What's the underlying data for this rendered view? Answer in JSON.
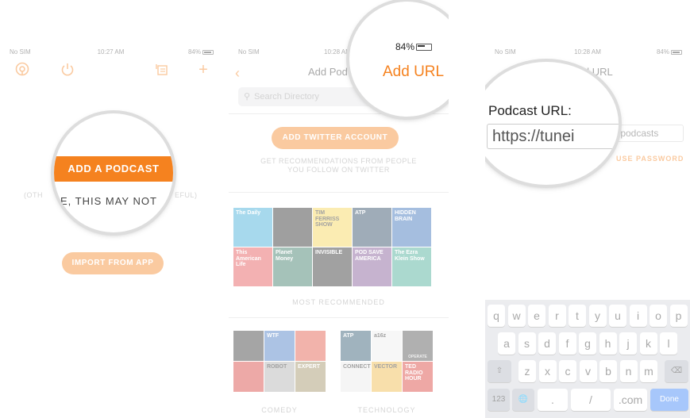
{
  "panel1": {
    "status": {
      "carrier": "No SIM",
      "time": "10:27 AM",
      "battery": "84%"
    },
    "toolbar": {
      "icons": [
        "podcast-icon",
        "power-icon",
        "episode-list-icon",
        "plus-icon"
      ],
      "plus": "+"
    },
    "add_podcast": "ADD A PODCAST",
    "note_left": "(OTH",
    "note_mid": "E, THIS MAY NOT",
    "note_right": "EFUL)",
    "import_button": "IMPORT FROM APP",
    "accent": "#f5821f"
  },
  "panel2": {
    "status": {
      "carrier": "No SIM",
      "time": "10:28 AM",
      "battery": "84%"
    },
    "nav_title": "Add Podc",
    "add_url": "Add URL",
    "search_placeholder": "Search Directory",
    "twitter_button": "ADD TWITTER ACCOUNT",
    "recommend_line1": "GET RECOMMENDATIONS FROM PEOPLE",
    "recommend_line2": "YOU FOLLOW ON TWITTER",
    "most_recommended": "MOST RECOMMENDED",
    "tiles": [
      {
        "text": "The Daily",
        "color": "#2fa7d6"
      },
      {
        "text": "",
        "color": "#1c1c1c"
      },
      {
        "text": "TIM FERRISS SHOW",
        "color": "#f6d24a"
      },
      {
        "text": "ATP",
        "color": "#1c3c58"
      },
      {
        "text": "HIDDEN BRAIN",
        "color": "#2a66b4"
      },
      {
        "text": "This American Life",
        "color": "#e3484a"
      },
      {
        "text": "Planet Money",
        "color": "#2c6f5b"
      },
      {
        "text": "INVISIBLE",
        "color": "#222222"
      },
      {
        "text": "POD SAVE AMERICA",
        "color": "#7a4d8f"
      },
      {
        "text": "The Ezra Klein Show",
        "color": "#3aa58f"
      }
    ],
    "comedy_tiles": [
      {
        "text": "",
        "color": "#2a2a2a"
      },
      {
        "text": "WTF",
        "color": "#3b73c0"
      },
      {
        "text": "",
        "color": "#e24d3a"
      },
      {
        "text": "",
        "color": "#d63530"
      },
      {
        "text": "ROBOT",
        "color": "#aaaaaa"
      },
      {
        "text": "EXPERT",
        "color": "#9b8a5a"
      }
    ],
    "tech_tiles": [
      {
        "text": "ATP",
        "color": "#1f4d66"
      },
      {
        "text": "a16z",
        "color": "#eeeeee"
      },
      {
        "text": "",
        "color": "#444444"
      },
      {
        "text": "CONNECTED",
        "color": "#e9e9e9"
      },
      {
        "text": "VECTOR",
        "color": "#f0b43a"
      },
      {
        "text": "TED RADIO HOUR",
        "color": "#d8322c"
      }
    ],
    "tech_sub": "OPERATE",
    "comedy": "COMEDY",
    "technology": "TECHNOLOGY"
  },
  "panel3": {
    "status": {
      "carrier": "No SIM",
      "time": "10:28 AM",
      "battery": "84%"
    },
    "nav_title": "Add URL",
    "url_label": "Podcast URL:",
    "url_value": "https://tunei",
    "url_value_tail": "m/podcasts",
    "use_password": "USE PASSWORD",
    "keyboard": {
      "row1": [
        "q",
        "w",
        "e",
        "r",
        "t",
        "y",
        "u",
        "i",
        "o",
        "p"
      ],
      "row2": [
        "a",
        "s",
        "d",
        "f",
        "g",
        "h",
        "j",
        "k",
        "l"
      ],
      "row3": [
        "z",
        "x",
        "c",
        "v",
        "b",
        "n",
        "m"
      ],
      "row4": [
        "123",
        ".",
        "/",
        ".com",
        "Done"
      ]
    }
  }
}
